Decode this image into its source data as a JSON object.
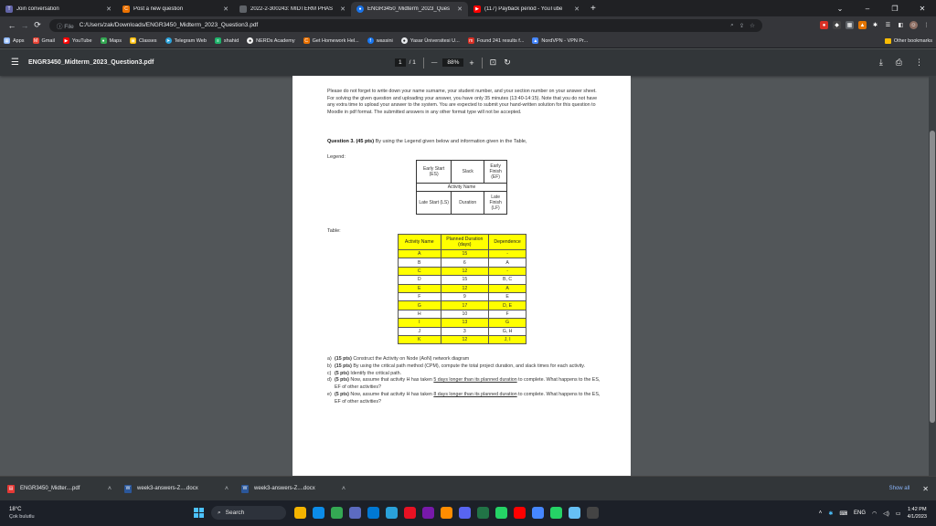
{
  "tabs": [
    {
      "label": "Join conversation",
      "icon": "teams-icon",
      "color": "#6264a7"
    },
    {
      "label": "Post a new question",
      "icon": "chegg-icon",
      "color": "#eb7100"
    },
    {
      "label": "2022-2-300243: MIDTERM PHAS",
      "icon": "blank-icon",
      "color": "#5f6368"
    },
    {
      "label": "ENGR3450_Midterm_2023_Ques",
      "icon": "chrome-icon",
      "color": "#1a73e8",
      "active": true
    },
    {
      "label": "(117) Payback period - YouTube",
      "icon": "youtube-icon",
      "color": "#ff0000"
    }
  ],
  "window_controls": {
    "minimize": "–",
    "restore": "❐",
    "close": "✕"
  },
  "address": {
    "protocol_label": "ⓘ File",
    "url": "C:/Users/zak/Downloads/ENGR3450_Midterm_2023_Question3.pdf"
  },
  "bookmarks": [
    {
      "label": "Apps",
      "icon": "apps-icon",
      "color": "#8ab4f8"
    },
    {
      "label": "Gmail",
      "icon": "gmail-icon",
      "color": "#ea4335"
    },
    {
      "label": "YouTube",
      "icon": "youtube-icon",
      "color": "#ff0000"
    },
    {
      "label": "Maps",
      "icon": "maps-icon",
      "color": "#34a853"
    },
    {
      "label": "Classes",
      "icon": "classes-icon",
      "color": "#fbbc04"
    },
    {
      "label": "Telegram Web",
      "icon": "telegram-icon",
      "color": "#2aa1da"
    },
    {
      "label": "shahid",
      "icon": "shahid-icon",
      "color": "#1fb36b"
    },
    {
      "label": "NERDs Academy",
      "icon": "nerds-icon",
      "color": "#f1f1f1"
    },
    {
      "label": "Get Homework Hel...",
      "icon": "chegg-icon",
      "color": "#eb7100"
    },
    {
      "label": "wassini",
      "icon": "facebook-icon",
      "color": "#1877f2"
    },
    {
      "label": "Yasar Üniversitesi U...",
      "icon": "yasar-icon",
      "color": "#e8eaed"
    },
    {
      "label": "Found 241 results f...",
      "icon": "results-icon",
      "color": "#d93025"
    },
    {
      "label": "NordVPN - VPN Pr...",
      "icon": "nordvpn-icon",
      "color": "#4687ff"
    }
  ],
  "other_bookmarks": "Other bookmarks",
  "pdf": {
    "title": "ENGR3450_Midterm_2023_Question3.pdf",
    "page_current": "1",
    "page_total": "/ 1",
    "zoom": "88%",
    "minus": "—",
    "plus": "+"
  },
  "document": {
    "intro": "Please do not forget to write down your name surname, your student number, and your section number on your answer sheet. For solving the given question and uploading your answer, you have only 35 minutes (13:40-14:15). Note that you do not have any extra time to upload your answer to the system. You are expected to submit your hand-written solution for this question to Moodle in pdf format. The submitted answers in any other format type will not be accepted.",
    "question_label": "Question 3. (45 pts)",
    "question_text": " By using the Legend given below and information given in the Table,",
    "legend_label": "Legend:",
    "legend": {
      "early_start": "Early Start (ES)",
      "slack": "Slack",
      "early_finish": "Early Finish (EF)",
      "activity_name": "Activity Name",
      "late_start": "Late Start (LS)",
      "duration": "Duration",
      "late_finish": "Late Finish (LF)"
    },
    "table_label": "Table:",
    "table": {
      "headers": [
        "Activity Name",
        "Planned Duration (days)",
        "Dependence"
      ],
      "rows": [
        [
          "A",
          "15",
          "-"
        ],
        [
          "B",
          "6",
          "A"
        ],
        [
          "C",
          "12",
          "-"
        ],
        [
          "D",
          "15",
          "B, C"
        ],
        [
          "E",
          "12",
          "A"
        ],
        [
          "F",
          "9",
          "E"
        ],
        [
          "G",
          "17",
          "D, E"
        ],
        [
          "H",
          "10",
          "F"
        ],
        [
          "I",
          "13",
          "G"
        ],
        [
          "J",
          "3",
          "G, H"
        ],
        [
          "K",
          "12",
          "J, I"
        ]
      ]
    },
    "tasks": [
      {
        "key": "a)",
        "pts": "(15 pts)",
        "text": " Construct the Activity on Node (AoN) network diagram"
      },
      {
        "key": "b)",
        "pts": "(15 pts)",
        "text": " By using the critical path method (CPM), compute the total project duration, and slack times for each activity."
      },
      {
        "key": "c)",
        "pts": "(5 pts)",
        "text": " Identify the critical path."
      },
      {
        "key": "d)",
        "pts": "(5 pts)",
        "text_pre": " Now, assume that activity H has taken ",
        "text_ul": "5 days longer than its planned duration",
        "text_post": " to complete. What happens to the ES, EF of other activities?"
      },
      {
        "key": "e)",
        "pts": "(5 pts)",
        "text_pre": " Now, assume that activity H has taken ",
        "text_ul": "8 days longer than its planned duration",
        "text_post": " to complete. What happens to the ES, EF of other activities?"
      }
    ]
  },
  "downloads": [
    {
      "label": "ENGR3450_Midter....pdf",
      "icon": "pdf-icon",
      "color": "#e53935"
    },
    {
      "label": "week3-answers-Z....docx",
      "icon": "word-icon",
      "color": "#2b579a"
    },
    {
      "label": "week3-answers-Z....docx",
      "icon": "word-icon",
      "color": "#2b579a"
    }
  ],
  "show_all": "Show all",
  "weather": {
    "temp": "18°C",
    "desc": "Çok bulutlu"
  },
  "taskbar": {
    "search_label": "Search",
    "icons": [
      {
        "name": "file-explorer-icon",
        "color": "#f4b400"
      },
      {
        "name": "edge-icon",
        "color": "#0c8ce9"
      },
      {
        "name": "chrome-icon",
        "color": "#34a853"
      },
      {
        "name": "store-icon",
        "color": "#5c6bc0"
      },
      {
        "name": "mail-icon",
        "color": "#0078d4"
      },
      {
        "name": "telegram-icon",
        "color": "#2aa1da"
      },
      {
        "name": "opera-icon",
        "color": "#e81123"
      },
      {
        "name": "onenote-icon",
        "color": "#7719aa"
      },
      {
        "name": "media-icon",
        "color": "#ff8c00"
      },
      {
        "name": "discord-icon",
        "color": "#5865f2"
      },
      {
        "name": "excel-icon",
        "color": "#217346"
      },
      {
        "name": "whatsapp-icon",
        "color": "#25d366"
      },
      {
        "name": "youtube-icon",
        "color": "#ff0000"
      },
      {
        "name": "vpn-icon",
        "color": "#4687ff"
      },
      {
        "name": "whatsapp2-icon",
        "color": "#25d366"
      },
      {
        "name": "steam-icon",
        "color": "#66c0f4"
      },
      {
        "name": "obs-icon",
        "color": "#444"
      }
    ],
    "lang": "ENG",
    "time": "1:42 PM",
    "date": "4/1/2023"
  }
}
